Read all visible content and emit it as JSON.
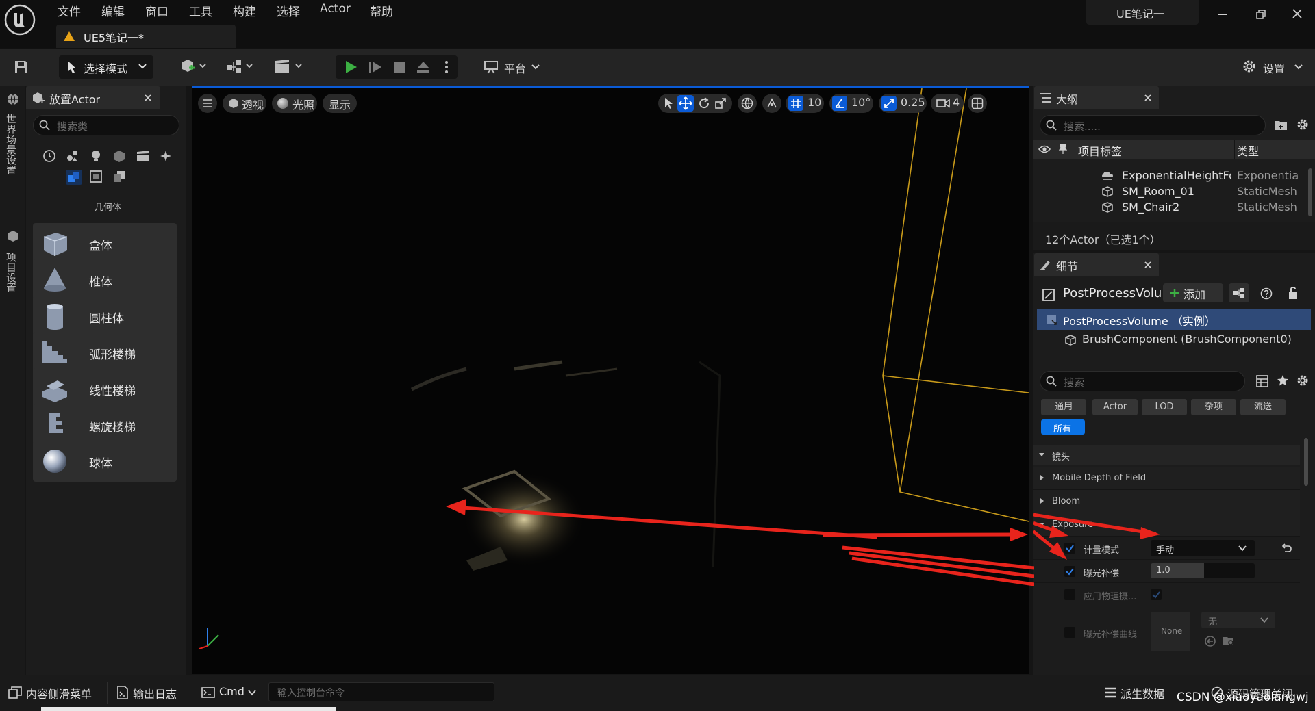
{
  "app": {
    "window_title": "UE笔记一",
    "document_tab": "UE5笔记一*"
  },
  "menu": [
    "文件",
    "编辑",
    "窗口",
    "工具",
    "构建",
    "选择",
    "Actor",
    "帮助"
  ],
  "toolbar": {
    "select_mode": "选择模式",
    "platform": "平台",
    "settings": "设置"
  },
  "left_strip": {
    "world_settings": "世界场景设置",
    "project_settings": "项目设置"
  },
  "place_actors": {
    "tab_title": "放置Actor",
    "search_placeholder": "搜索类",
    "category_label": "几何体",
    "items": [
      {
        "label": "盒体",
        "icon": "box-icon"
      },
      {
        "label": "椎体",
        "icon": "cone-icon"
      },
      {
        "label": "圆柱体",
        "icon": "cylinder-icon"
      },
      {
        "label": "弧形楼梯",
        "icon": "curved-stairs-icon"
      },
      {
        "label": "线性楼梯",
        "icon": "linear-stairs-icon"
      },
      {
        "label": "螺旋楼梯",
        "icon": "spiral-stairs-icon"
      },
      {
        "label": "球体",
        "icon": "sphere-icon"
      }
    ]
  },
  "viewport": {
    "perspective": "透视",
    "lighting": "光照",
    "show": "显示",
    "grid_snap": "10",
    "rotation_snap": "10°",
    "scale_snap": "0.25",
    "camera_speed": "4"
  },
  "outliner": {
    "tab_title": "大纲",
    "search_placeholder": "搜索.....",
    "col_label": "项目标签",
    "col_type": "类型",
    "rows": [
      {
        "name": "ExponentialHeightFo",
        "type": "Exponentia"
      },
      {
        "name": "SM_Room_01",
        "type": "StaticMesh"
      },
      {
        "name": "SM_Chair2",
        "type": "StaticMesh"
      }
    ],
    "status": "12个Actor（已选1个）"
  },
  "details": {
    "tab_title": "细节",
    "actor_name": "PostProcessVolu",
    "add_button": "添加",
    "components": [
      {
        "label": "PostProcessVolume （实例）",
        "selected": true
      },
      {
        "label": "BrushComponent (BrushComponent0)",
        "selected": false
      }
    ],
    "search_placeholder": "搜索",
    "filters": [
      "通用",
      "Actor",
      "LOD",
      "杂项",
      "流送"
    ],
    "filter_all": "所有",
    "sections": {
      "lens": "镜头",
      "mobile_dof": "Mobile Depth of Field",
      "bloom": "Bloom",
      "exposure": "Exposure"
    },
    "props": {
      "metering_mode_label": "计量模式",
      "metering_mode_value": "手动",
      "exposure_comp_label": "曝光补偿",
      "exposure_comp_value": "1.0",
      "apply_physical_label": "应用物理摄...",
      "exposure_curve_label": "曝光补偿曲线",
      "curve_asset_none": "None",
      "curve_dropdown": "无"
    }
  },
  "bottom": {
    "content_drawer": "内容侧滑菜单",
    "output_log": "输出日志",
    "cmd": "Cmd",
    "console_placeholder": "输入控制台命令",
    "derived_data": "派生数据",
    "source_control": "源码管理关闭",
    "watermark": "CSDN @xiaoyaolangwj"
  },
  "colors": {
    "accent_blue": "#0b5bd6",
    "play_green": "#3cb043",
    "annotation_red": "#e8241c",
    "wire_orange": "#c89a1a"
  }
}
